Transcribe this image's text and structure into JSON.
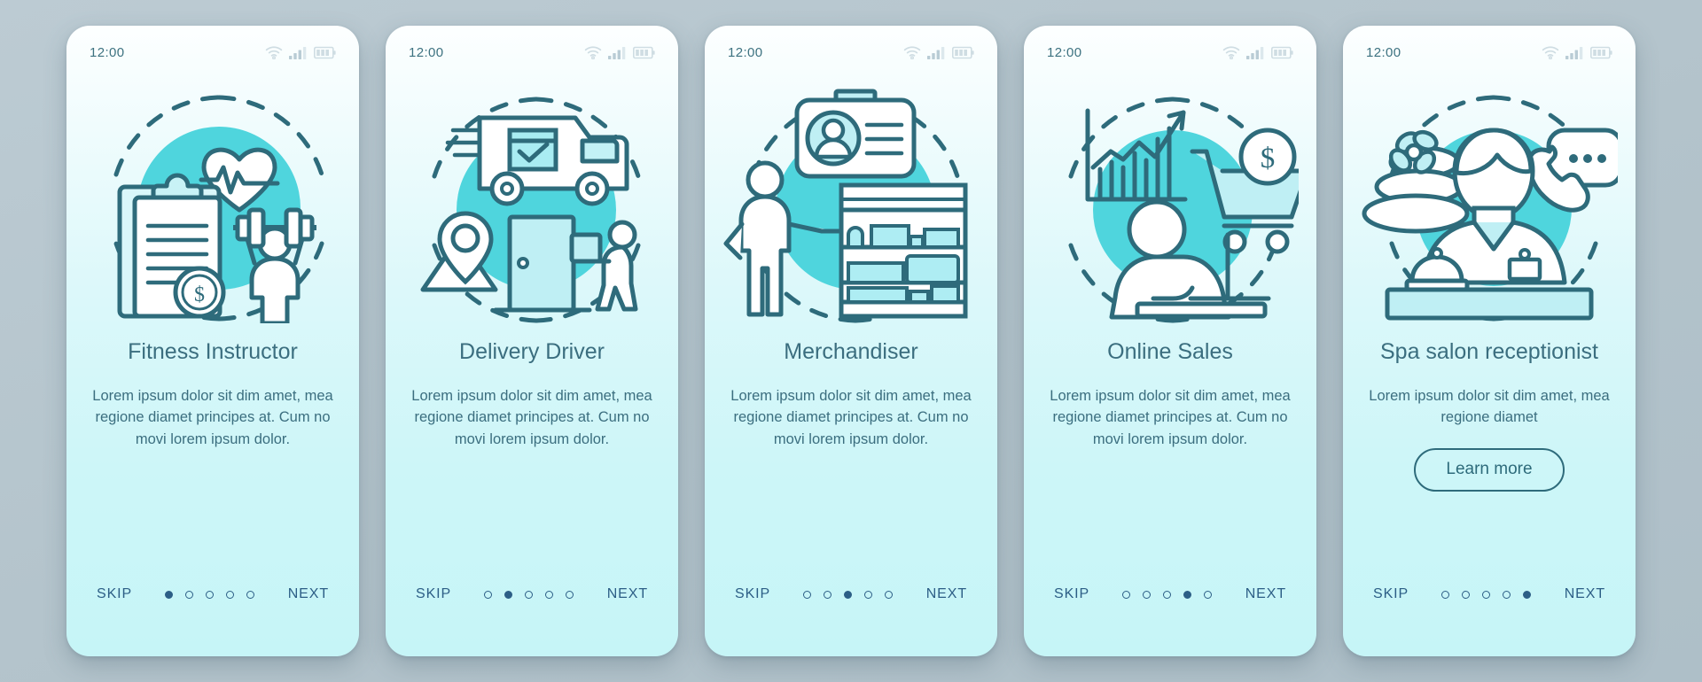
{
  "background_color": "#b6c6ce",
  "theme": {
    "accent": "#4fd5dd",
    "outline": "#2e6b7b",
    "text": "#3b6e7f",
    "nav_text": "#2c5e86",
    "card_gradient_top": "#fdffff",
    "card_gradient_bottom": "#c6f5f7"
  },
  "status_bar": {
    "time": "12:00",
    "icons": [
      "wifi-icon",
      "cellular-signal-icon",
      "battery-icon"
    ]
  },
  "nav": {
    "skip_label": "SKIP",
    "next_label": "NEXT",
    "total_dots": 5
  },
  "screens": [
    {
      "id": "fitness-instructor",
      "illustration": "fitness-illustration",
      "illustration_parts": [
        "clipboard",
        "heartbeat-heart",
        "dollar-coin",
        "weightlifter",
        "barbell",
        "dashed-circle"
      ],
      "title": "Fitness Instructor",
      "description": "Lorem ipsum dolor sit dim amet, mea regione diamet principes at. Cum no movi lorem ipsum dolor.",
      "active_dot": 1,
      "cta": null
    },
    {
      "id": "delivery-driver",
      "illustration": "delivery-illustration",
      "illustration_parts": [
        "delivery-van",
        "package-check",
        "map-pin",
        "door",
        "courier-with-box",
        "dashed-circle"
      ],
      "title": "Delivery Driver",
      "description": "Lorem ipsum dolor sit dim amet, mea regione diamet principes at. Cum no movi lorem ipsum dolor.",
      "active_dot": 2,
      "cta": null
    },
    {
      "id": "merchandiser",
      "illustration": "merchandiser-illustration",
      "illustration_parts": [
        "id-badge",
        "standing-person",
        "product-shelf",
        "dashed-circle"
      ],
      "title": "Merchandiser",
      "description": "Lorem ipsum dolor sit dim amet, mea regione diamet principes at. Cum no movi lorem ipsum dolor.",
      "active_dot": 3,
      "cta": null
    },
    {
      "id": "online-sales",
      "illustration": "online-sales-illustration",
      "illustration_parts": [
        "growth-bar-chart",
        "shopping-cart",
        "dollar-coin",
        "person-at-laptop",
        "dashed-circle"
      ],
      "title": "Online Sales",
      "description": "Lorem ipsum dolor sit dim amet, mea regione diamet principes at. Cum no movi lorem ipsum dolor.",
      "active_dot": 4,
      "cta": null
    },
    {
      "id": "spa-salon-receptionist",
      "illustration": "spa-receptionist-illustration",
      "illustration_parts": [
        "zen-stones",
        "flower",
        "receptionist-woman",
        "name-tag",
        "service-bell",
        "phone-handset",
        "speech-bubble",
        "desk",
        "dashed-circle"
      ],
      "title": "Spa salon receptionist",
      "description": "Lorem ipsum dolor sit dim amet, mea regione diamet",
      "active_dot": 5,
      "cta": "Learn more"
    }
  ]
}
